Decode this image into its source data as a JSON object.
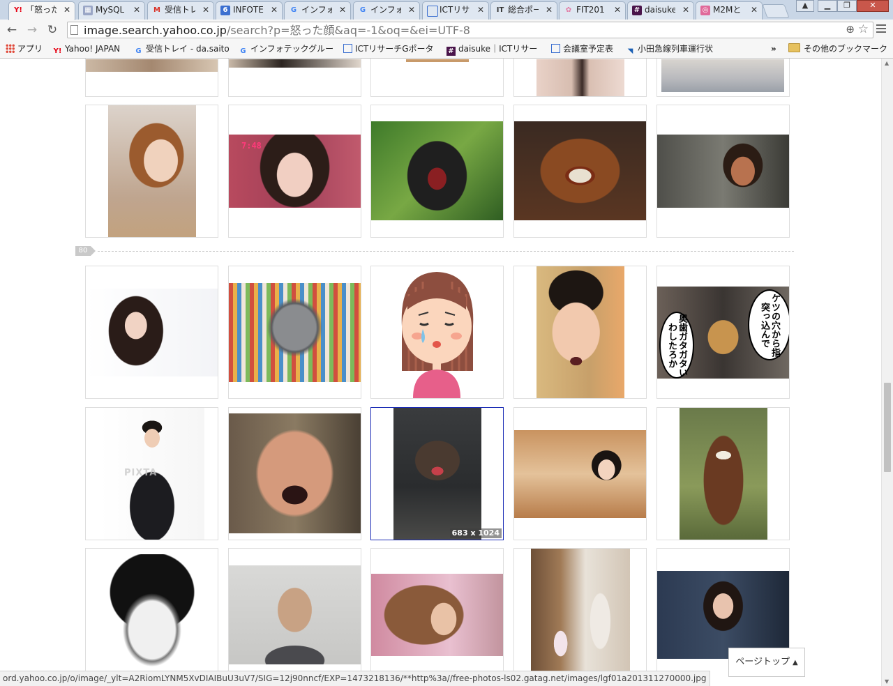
{
  "tabs": [
    {
      "label": "「怒った",
      "icon": "yahoo-favicon",
      "active": true
    },
    {
      "label": "MySQL",
      "icon": "grid-favicon"
    },
    {
      "label": "受信トレ",
      "icon": "gmail-favicon"
    },
    {
      "label": "INFOTE",
      "icon": "six-favicon"
    },
    {
      "label": "インフォ",
      "icon": "google-favicon"
    },
    {
      "label": "インフォ",
      "icon": "google-favicon"
    },
    {
      "label": "ICTリサ",
      "icon": "portal-favicon"
    },
    {
      "label": "総合ポー",
      "icon": "it-favicon"
    },
    {
      "label": "FIT201",
      "icon": "flower-favicon"
    },
    {
      "label": "daisuke",
      "icon": "slack-favicon"
    },
    {
      "label": "M2Mと",
      "icon": "rss-favicon"
    }
  ],
  "close_glyph": "✕",
  "address": {
    "host": "image.search.yahoo.co.jp",
    "path": "/search?p=怒った顔&aq=-1&oq=&ei=UTF-8"
  },
  "bookmarks": [
    {
      "label": "アプリ",
      "icon": "apps-icon"
    },
    {
      "label": "Yahoo! JAPAN",
      "icon": "yahoo-icon"
    },
    {
      "label": "受信トレイ - da.saito",
      "icon": "google-icon"
    },
    {
      "label": "インフォテックグルー",
      "icon": "google-icon"
    },
    {
      "label": "ICTリサーチGポータ",
      "icon": "portal-icon"
    },
    {
      "label": "daisuke｜ICTリサー",
      "icon": "slack-icon"
    },
    {
      "label": "会議室予定表",
      "icon": "portal-icon"
    },
    {
      "label": "小田急線列車運行状",
      "icon": "odakyu-icon"
    }
  ],
  "bookmarks_overflow": "»",
  "other_bookmarks": "その他のブックマーク",
  "divider_number": "80",
  "hover_size": {
    "w": "683",
    "x": " x ",
    "h": "1024"
  },
  "tv_overlay": "7:48",
  "speech_bubbles": {
    "right": "ケツの穴から指突っ込んで",
    "left": "奥歯ガタガタいわしたろか"
  },
  "watermark": "PIXTA",
  "page_top_label": "ページトップ",
  "page_top_arrow": "▲",
  "status_url": "ord.yahoo.co.jp/o/image/_ylt=A2RiomLYNM5XvDIAIBuU3uV7/SIG=12j90nncf/EXP=1473218136/**http%3a//free-photos-ls02.gatag.net/images/lgf01a201311270000.jpg",
  "thumbnails": [
    {
      "subject": "partial-image"
    },
    {
      "subject": "partial-image"
    },
    {
      "subject": "partial-image"
    },
    {
      "subject": "partial-image"
    },
    {
      "subject": "partial-image"
    },
    {
      "subject": "woman-short-hair"
    },
    {
      "subject": "tv-announcer"
    },
    {
      "subject": "gorilla-roaring"
    },
    {
      "subject": "dog-snarling"
    },
    {
      "subject": "man-shouting-gun"
    },
    {
      "subject": "woman-crossed-arms"
    },
    {
      "subject": "grumpy-persian-cat"
    },
    {
      "subject": "crying-girl-illustration"
    },
    {
      "subject": "angry-boy"
    },
    {
      "subject": "dog-meme"
    },
    {
      "subject": "businessman-arms-crossed"
    },
    {
      "subject": "old-man-shouting"
    },
    {
      "subject": "otter-snarling"
    },
    {
      "subject": "pouting-girl"
    },
    {
      "subject": "horse-teeth"
    },
    {
      "subject": "manga-angry-face"
    },
    {
      "subject": "man-frowning"
    },
    {
      "subject": "girl-looking-up"
    },
    {
      "subject": "mother-child"
    },
    {
      "subject": "woman-trenchcoat"
    }
  ]
}
